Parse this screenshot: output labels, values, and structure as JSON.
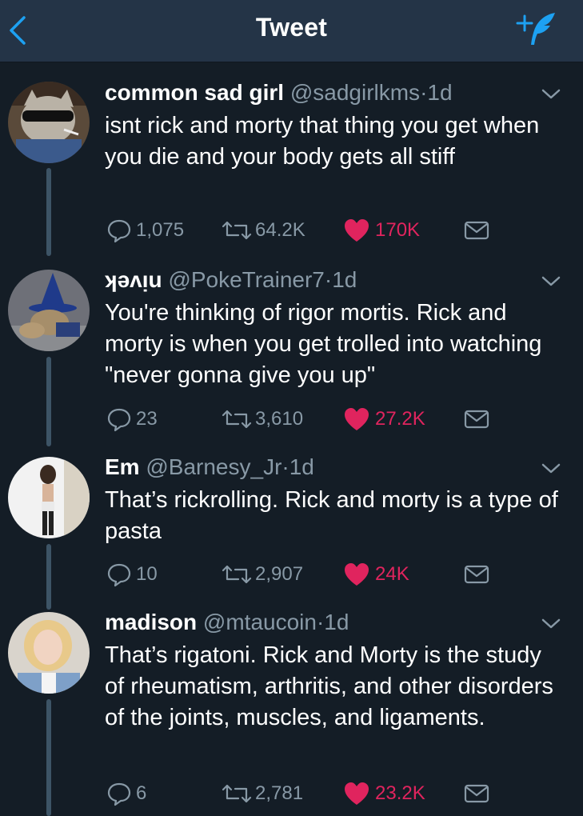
{
  "header": {
    "title": "Tweet",
    "back_icon": "chevron-left-icon",
    "compose_icon": "compose-tweet-icon",
    "accent": "#1da1f2"
  },
  "colors": {
    "background": "#141d26",
    "nav": "#243447",
    "secondary_text": "#8899a6",
    "like": "#e0245e",
    "thread_line": "#3d5466"
  },
  "tweets": [
    {
      "name": "common sad girl",
      "handle": "@sadgirlkms",
      "dot": "·",
      "time": "1d",
      "text": "isnt rick and morty that thing you get when you die and your body gets all stiff",
      "replies": "1,075",
      "retweets": "64.2K",
      "likes": "170K",
      "liked": true
    },
    {
      "name": "ʞǝʌᴉu",
      "handle": "@PokeTrainer7",
      "dot": "·",
      "time": "1d",
      "text": "You're thinking of rigor mortis. Rick and morty is when you get trolled into watching \"never gonna give you up\"",
      "replies": "23",
      "retweets": "3,610",
      "likes": "27.2K",
      "liked": true
    },
    {
      "name": "Em",
      "handle": "@Barnesy_Jr",
      "dot": "·",
      "time": "1d",
      "text": "That’s rickrolling. Rick and morty is a type of pasta",
      "replies": "10",
      "retweets": "2,907",
      "likes": "24K",
      "liked": true
    },
    {
      "name": "madison",
      "handle": "@mtaucoin",
      "dot": "·",
      "time": "1d",
      "text": "That’s rigatoni. Rick and Morty is the study of rheumatism, arthritis, and other disorders of the joints, muscles, and ligaments.",
      "replies": "6",
      "retweets": "2,781",
      "likes": "23.2K",
      "liked": true
    }
  ]
}
